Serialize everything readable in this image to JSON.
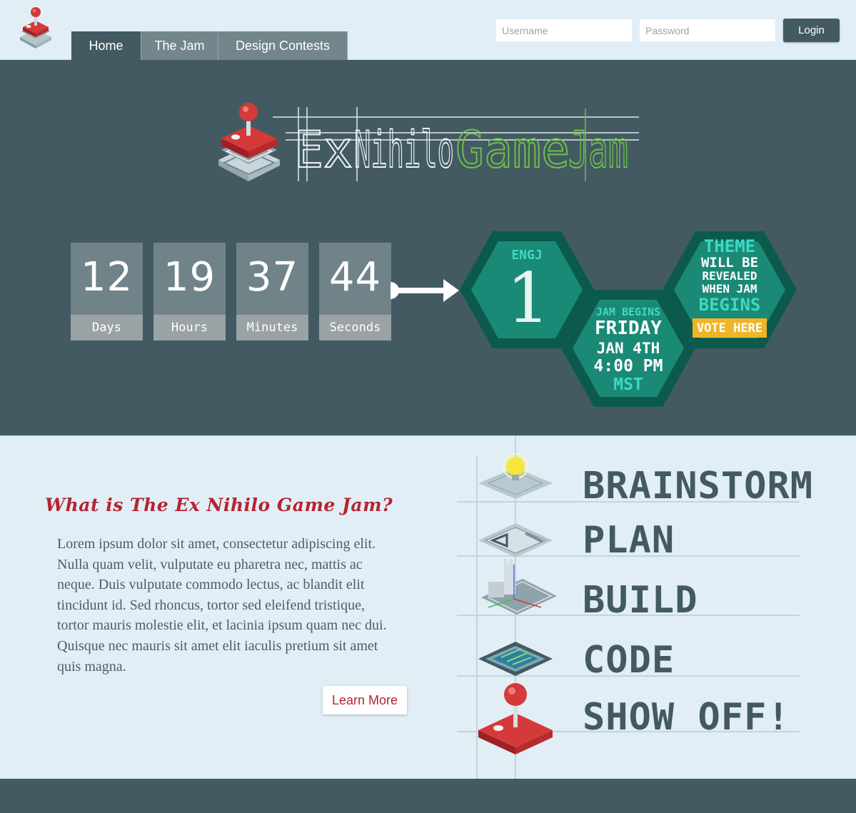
{
  "header": {
    "nav": [
      {
        "label": "Home",
        "active": true
      },
      {
        "label": "The Jam",
        "active": false
      },
      {
        "label": "Design Contests",
        "active": false
      }
    ],
    "username_placeholder": "Username",
    "password_placeholder": "Password",
    "login_label": "Login"
  },
  "hero": {
    "logo_text": {
      "ex": "Ex",
      "nihilo": "Nihilo",
      "game": "Game",
      "jam": "Jam"
    },
    "countdown": [
      {
        "value": "12",
        "label": "Days"
      },
      {
        "value": "19",
        "label": "Hours"
      },
      {
        "value": "37",
        "label": "Minutes"
      },
      {
        "value": "44",
        "label": "Seconds"
      }
    ],
    "badge": {
      "engj": "ENGJ",
      "number": "1",
      "jam_begins": "JAM BEGINS",
      "day": "FRIDAY",
      "date": "JAN 4TH",
      "time": "4:00 PM",
      "zone": "MST",
      "theme": "THEME",
      "will_be": "WILL BE",
      "revealed": "REVEALED",
      "when_jam": "WHEN JAM",
      "begins": "BEGINS",
      "vote": "VOTE HERE"
    }
  },
  "about": {
    "title": "What is The Ex Nihilo Game Jam?",
    "body": "Lorem ipsum dolor sit amet, consectetur adipiscing elit. Nulla quam velit, vulputate eu pharetra nec, mattis ac neque. Duis vulputate commodo lectus, ac blandit elit tincidunt id. Sed rhoncus, tortor sed eleifend tristique, tortor mauris molestie elit, et lacinia ipsum quam nec dui. Quisque nec mauris sit amet elit iaculis pretium sit amet quis magna.",
    "learn_more": "Learn More",
    "steps": [
      "BRAINSTORM",
      "PLAN",
      "BUILD",
      "CODE",
      "SHOW OFF!"
    ]
  },
  "colors": {
    "primary": "#435a63",
    "accent_red": "#b52430",
    "teal": "#1a8a76",
    "teal_dark": "#0b5a4c",
    "teal_light": "#3fd8c2",
    "yellow": "#f0b429",
    "logo_green": "#6cc24a",
    "background": "#e1eef5"
  }
}
